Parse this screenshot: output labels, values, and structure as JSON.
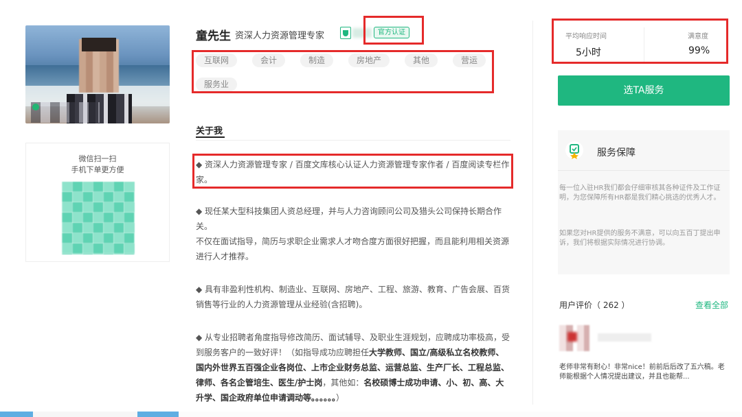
{
  "profile": {
    "name": "童先生",
    "title": "资深人力资源管理专家",
    "badge": "官方认证"
  },
  "qr": {
    "line1": "微信扫一扫",
    "line2": "手机下单更方便"
  },
  "tags": [
    "互联网",
    "会计",
    "制造",
    "房地产",
    "其他",
    "营运",
    "服务业"
  ],
  "about": {
    "heading": "关于我",
    "p1": "◆ 资深人力资源管理专家 / 百度文库核心认证人力资源管理专家作者 / 百度阅读专栏作家。",
    "p2a": "◆ 现任某大型科技集团人资总经理，并与人力咨询顾问公司及猎头公司保持长期合作关。",
    "p2b": "不仅在面试指导，简历与求职企业需求人才吻合度方面很好把握，而且能利用相关资源进行人才推荐。",
    "p3": "◆ 具有非盈利性机构、制造业、互联网、房地产、工程、旅游、教育、广告会展、百货销售等行业的人力资源管理从业经验(含招聘)。",
    "p4_normal": "◆ 从专业招聘者角度指导修改简历、面试辅导、及职业生涯规划，应聘成功率极高，受到服务客户的一致好评！（如指导成功应聘担任",
    "p4_bold1": "大学教师、国立/高级私立名校教师、国内外世界五百强企业各岗位、上市企业财务总监、运营总监、生产厂长、工程总监、律师、各名企管培生、医生/护士岗",
    "p4_mid": "，其他如：",
    "p4_bold2": "名校硕博士成功申请、小、初、高、大升学、国企政府单位申请调动等。。。。。。",
    "p4_end": "）"
  },
  "stats": {
    "response_label": "平均响应时间",
    "response_value": "5小时",
    "satisfaction_label": "满意度",
    "satisfaction_value": "99%"
  },
  "cta": "选TA服务",
  "guarantee": {
    "title": "服务保障",
    "text1": "每一位入驻HR我们都会仔细审核其各种证件及工作证明，为您保障所有HR都是我们精心挑选的优秀人才。",
    "text2": "如果您对HR提供的服务不满意，可以向五百丁提出申诉，我们将根据实际情况进行协调。"
  },
  "reviews": {
    "title": "用户评价（ 262 ）",
    "view_all": "查看全部",
    "first_text": "老师非常有耐心！非常nice！前前后后改了五六稿。老师能根据个人情况提出建议，并且也能帮..."
  },
  "colors": {
    "accent": "#1fb780",
    "highlight": "#e52a2a"
  }
}
